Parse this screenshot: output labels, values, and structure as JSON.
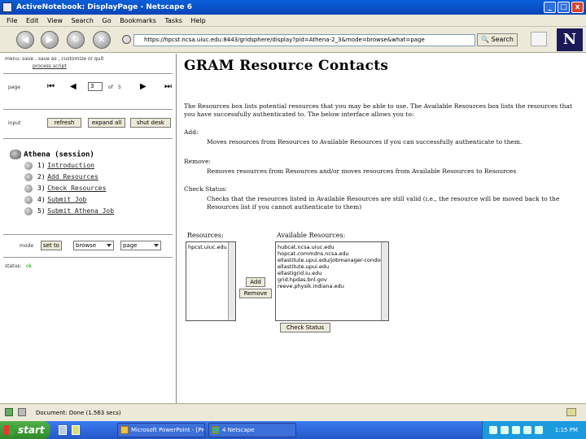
{
  "window": {
    "title": "ActiveNotebook: DisplayPage - Netscape 6",
    "controls": [
      "_",
      "□",
      "x"
    ]
  },
  "menu": [
    "File",
    "Edit",
    "View",
    "Search",
    "Go",
    "Bookmarks",
    "Tasks",
    "Help"
  ],
  "navbar": {
    "url": "https://hpcst.ncsa.uiuc.edu:8443/gridsphere/display?pid=Athena-2_3&mode=browse&what=page",
    "search_label": "Search",
    "logo": "N"
  },
  "left": {
    "menu_line": "menu: save , save as , customize or quit",
    "process_script": "process script",
    "page_label": "page",
    "page_value": "3",
    "of_label": "of",
    "page_total": "5",
    "input_label": "input",
    "buttons": [
      "refresh",
      "expand all",
      "shut desk"
    ],
    "tree": {
      "root": "Athena (session)",
      "items": [
        {
          "num": "1)",
          "label": "Introduction"
        },
        {
          "num": "2)",
          "label": "Add Resources"
        },
        {
          "num": "3)",
          "label": "Check Resources"
        },
        {
          "num": "4)",
          "label": "Submit Job"
        },
        {
          "num": "5)",
          "label": "Submit Athena Job"
        }
      ]
    },
    "mode_label": "mode",
    "mode_button": "set to",
    "mode_select1": "browse",
    "mode_select2": "page",
    "status_label": "status:",
    "status_value": "ok"
  },
  "main": {
    "title": "GRAM Resource Contacts",
    "intro": "The Resources box lists potential resources that you may be able to use. The Available Resources box lists the resources that you have successfully authenticated to. The below interface allows you to:",
    "add_term": "Add:",
    "add_desc": "Moves resources from Resources to Available Resources if you can successfully authenticate to them.",
    "remove_term": "Remove:",
    "remove_desc": "Removes resources from Resources and/or moves resources from Available Resources to Resources",
    "check_term": "Check Status:",
    "check_desc": "Checks that the resources listed in Available Resources are still valid (i.e., the resource will be moved back to the Resources list if you cannot authenticate to them)",
    "resources_label": "Resources:",
    "resources": [
      "hpcst.uiuc.edu"
    ],
    "available_label": "Available Resources:",
    "available": [
      "hubcat.ncsa.uiuc.edu",
      "hopcat.commdns.ncsa.edu",
      "ellastitute.upui.edu/jobmanager-condor",
      "ellastitute.upui.edu",
      "ellastigrid.iu.edu",
      "grid.hpdas.bnl.gov",
      "reeve.physik.indiana.edu"
    ],
    "add_button": "Add",
    "remove_button": "Remove",
    "check_button": "Check Status"
  },
  "statusbar": {
    "text": "Document: Done (1.563 secs)"
  },
  "taskbar": {
    "start": "start",
    "tasks": [
      "Microsoft PowerPoint - [Pre...",
      "4 Netscape"
    ],
    "clock": "1:15 PM"
  }
}
